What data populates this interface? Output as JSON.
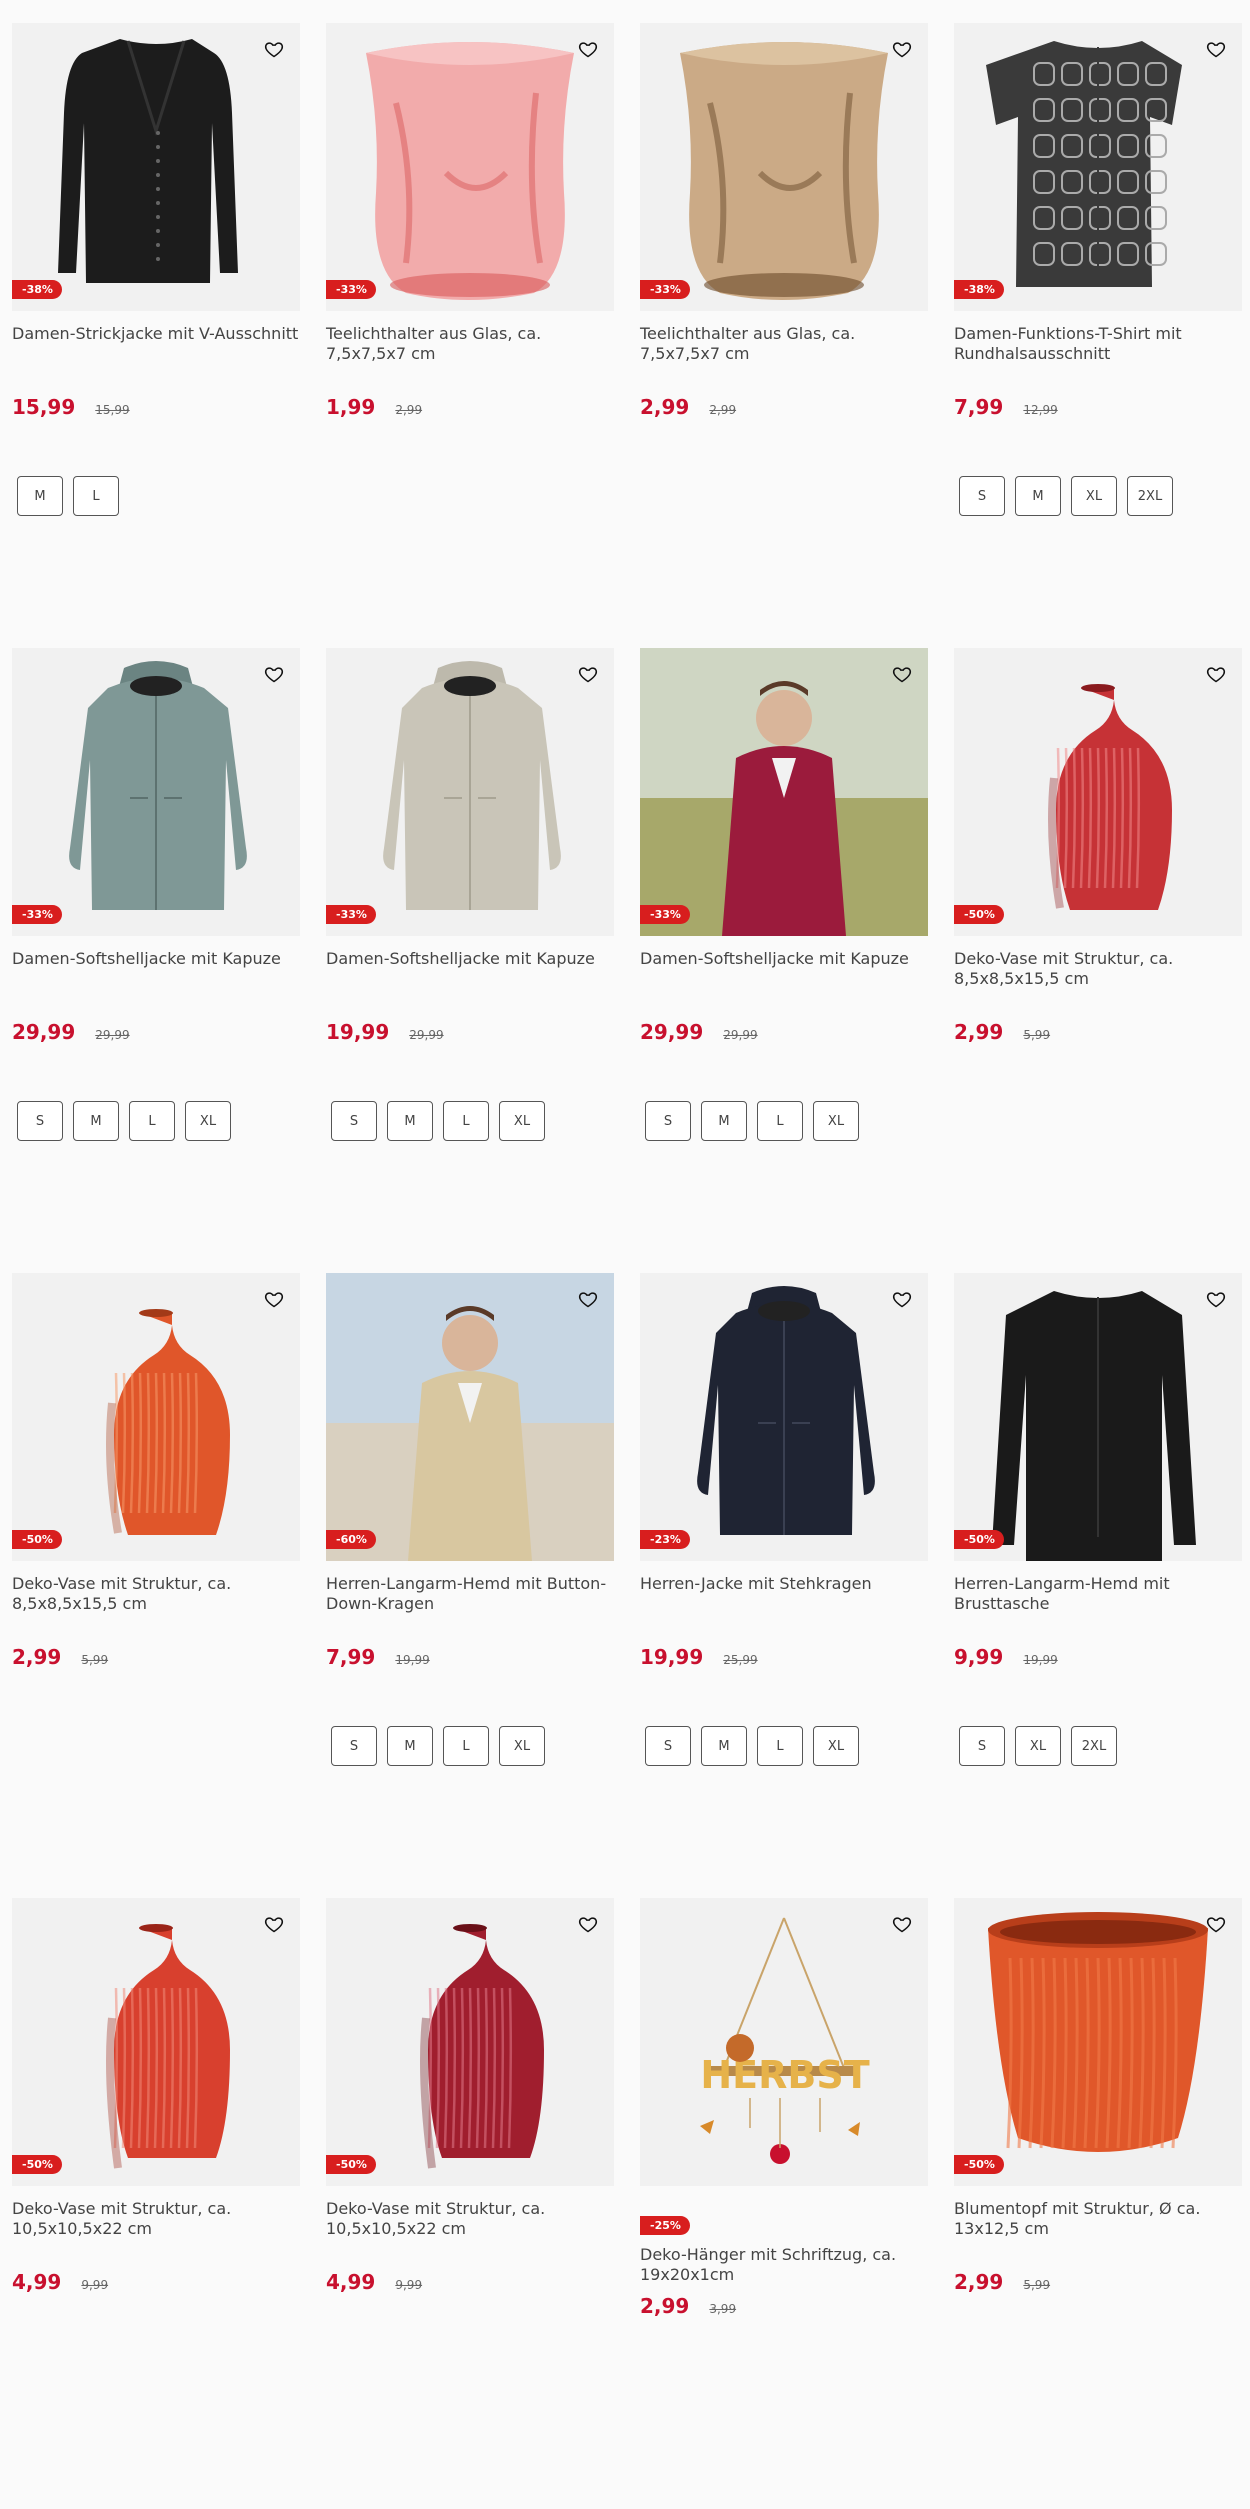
{
  "products": [
    {
      "title": "Damen-Strickjacke mit V-Ausschnitt",
      "badge": "-38%",
      "price": "15,99",
      "old_price": "15,99",
      "sizes": [
        "M",
        "L"
      ],
      "image": "black-cardigan"
    },
    {
      "title": "Teelichthalter aus Glas, ca. 7,5x7,5x7 cm",
      "badge": "-33%",
      "price": "1,99",
      "old_price": "2,99",
      "sizes": [],
      "image": "pink-glass"
    },
    {
      "title": "Teelichthalter aus Glas, ca. 7,5x7,5x7 cm",
      "badge": "-33%",
      "price": "2,99",
      "old_price": "2,99",
      "sizes": [],
      "image": "amber-glass"
    },
    {
      "title": "Damen-Funktions-T-Shirt mit Rundhalsausschnitt",
      "badge": "-38%",
      "price": "7,99",
      "old_price": "12,99",
      "sizes": [
        "S",
        "M",
        "XL",
        "2XL"
      ],
      "image": "patterned-tshirt"
    },
    {
      "title": "Damen-Softshelljacke mit Kapuze",
      "badge": "-33%",
      "price": "29,99",
      "old_price": "29,99",
      "sizes": [
        "S",
        "M",
        "L",
        "XL"
      ],
      "image": "sage-jacket"
    },
    {
      "title": "Damen-Softshelljacke mit Kapuze",
      "badge": "-33%",
      "price": "19,99",
      "old_price": "29,99",
      "sizes": [
        "S",
        "M",
        "L",
        "XL"
      ],
      "image": "beige-jacket"
    },
    {
      "title": "Damen-Softshelljacke mit Kapuze",
      "badge": "-33%",
      "price": "29,99",
      "old_price": "29,99",
      "sizes": [
        "S",
        "M",
        "L",
        "XL"
      ],
      "image": "woman-red-jacket"
    },
    {
      "title": "Deko-Vase mit Struktur, ca. 8,5x8,5x15,5 cm",
      "badge": "-50%",
      "price": "2,99",
      "old_price": "5,99",
      "sizes": [],
      "image": "red-vase"
    },
    {
      "title": "Deko-Vase mit Struktur, ca. 8,5x8,5x15,5 cm",
      "badge": "-50%",
      "price": "2,99",
      "old_price": "5,99",
      "sizes": [],
      "image": "orange-vase"
    },
    {
      "title": "Herren-Langarm-Hemd mit Button-Down-Kragen",
      "badge": "-60%",
      "price": "7,99",
      "old_price": "19,99",
      "sizes": [
        "S",
        "M",
        "L",
        "XL"
      ],
      "image": "man-patterned-shirt"
    },
    {
      "title": "Herren-Jacke mit Stehkragen",
      "badge": "-23%",
      "price": "19,99",
      "old_price": "25,99",
      "sizes": [
        "S",
        "M",
        "L",
        "XL"
      ],
      "image": "navy-jacket"
    },
    {
      "title": "Herren-Langarm-Hemd mit Brusttasche",
      "badge": "-50%",
      "price": "9,99",
      "old_price": "19,99",
      "sizes": [
        "S",
        "XL",
        "2XL"
      ],
      "image": "black-shirt"
    },
    {
      "title": "Deko-Vase mit Struktur, ca. 10,5x10,5x22 cm",
      "badge": "-50%",
      "price": "4,99",
      "old_price": "9,99",
      "sizes": [],
      "image": "coral-vase"
    },
    {
      "title": "Deko-Vase mit Struktur, ca. 10,5x10,5x22 cm",
      "badge": "-50%",
      "price": "4,99",
      "old_price": "9,99",
      "sizes": [],
      "image": "burgundy-vase"
    },
    {
      "title": "Deko-Hänger mit Schriftzug, ca. 19x20x1cm",
      "badge": "-25%",
      "price": "2,99",
      "old_price": "3,99",
      "sizes": [],
      "image": "autumn-hanger",
      "badge_below_image": true
    },
    {
      "title": "Blumentopf mit Struktur, Ø ca. 13x12,5 cm",
      "badge": "-50%",
      "price": "2,99",
      "old_price": "5,99",
      "sizes": [],
      "image": "orange-flowerpot"
    }
  ],
  "favorite_icon": "heart-outline-icon",
  "colors": {
    "price": "#c8102e",
    "badge": "#d81e1e"
  }
}
